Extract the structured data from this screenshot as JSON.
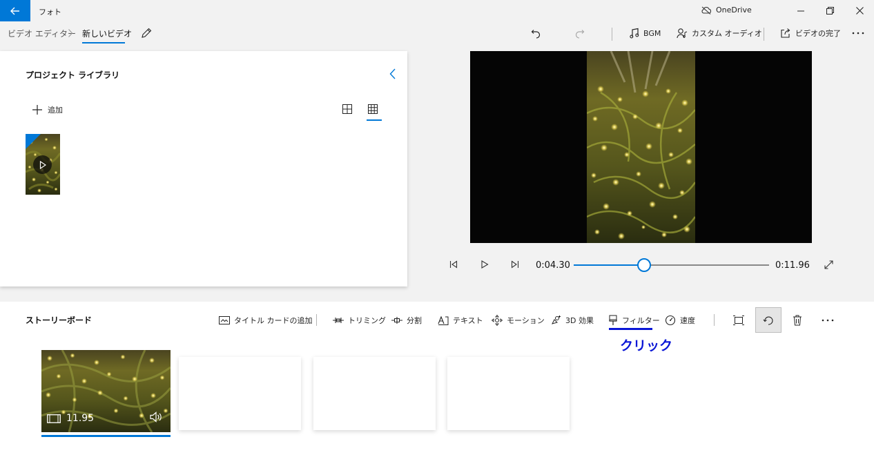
{
  "app": {
    "title": "フォト",
    "onedrive_label": "OneDrive"
  },
  "breadcrumb": {
    "root": "ビデオ エディター",
    "current": "新しいビデオ"
  },
  "toolbar": {
    "bgm_label": "BGM",
    "custom_audio_label": "カスタム オーディオ",
    "finish_label": "ビデオの完了"
  },
  "library": {
    "title": "プロジェクト ライブラリ",
    "add_label": "追加"
  },
  "player": {
    "current_time": "0:04.30",
    "total_time": "0:11.96",
    "progress": 0.36
  },
  "storyboard": {
    "title": "ストーリーボード",
    "actions": {
      "title_card": "タイトル カードの追加",
      "trim": "トリミング",
      "split": "分割",
      "text": "テキスト",
      "motion": "モーション",
      "effects_3d": "3D 効果",
      "filter": "フィルター",
      "speed": "速度"
    },
    "clip": {
      "duration": "11.95"
    }
  },
  "annotation": {
    "click_label": "クリック",
    "color": "#0a16d6"
  },
  "colors": {
    "accent": "#0078d7"
  }
}
